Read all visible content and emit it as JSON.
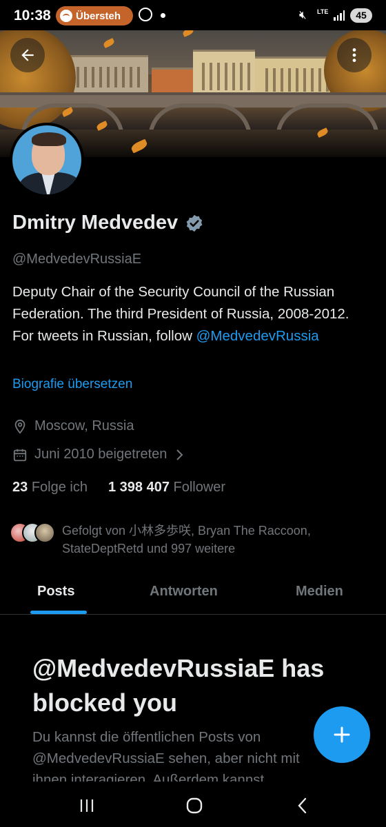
{
  "status_bar": {
    "time": "10:38",
    "media_app_label": "Übersteh",
    "network": "LTE",
    "battery": "45"
  },
  "profile": {
    "name": "Dmitry Medvedev",
    "handle": "@MedvedevRussiaE",
    "bio_text": "Deputy Chair of the Security Council of the Russian Federation. The third President of Russia, 2008-2012. For tweets in Russian, follow ",
    "bio_mention": "@MedvedevRussia",
    "translate_bio": "Biografie übersetzen",
    "location": "Moscow, Russia",
    "joined": "Juni 2010 beigetreten",
    "following_count": "23",
    "following_label": "Folge ich",
    "followers_count": "1 398 407",
    "followers_label": "Follower",
    "followed_by": "Gefolgt von 小林多歩咲, Bryan The Raccoon, StateDeptRetd und 997 weitere"
  },
  "tabs": [
    {
      "label": "Posts",
      "active": true
    },
    {
      "label": "Antworten",
      "active": false
    },
    {
      "label": "Medien",
      "active": false
    }
  ],
  "blocked": {
    "title": "@MedvedevRussiaE has blocked you",
    "text": "Du kannst die öffentlichen Posts von @MedvedevRussiaE sehen, aber nicht mit ihnen interagieren. Außerdem kannst"
  },
  "icons": {
    "back": "back-arrow-icon",
    "more": "more-vertical-icon",
    "verified": "verified-badge-icon",
    "location": "location-pin-icon",
    "calendar": "calendar-icon",
    "compose": "plus-icon"
  },
  "colors": {
    "accent": "#1d9bf0",
    "background": "#000000",
    "text_primary": "#e7e9ea",
    "text_secondary": "#71767b",
    "verified_badge": "#829aab"
  }
}
